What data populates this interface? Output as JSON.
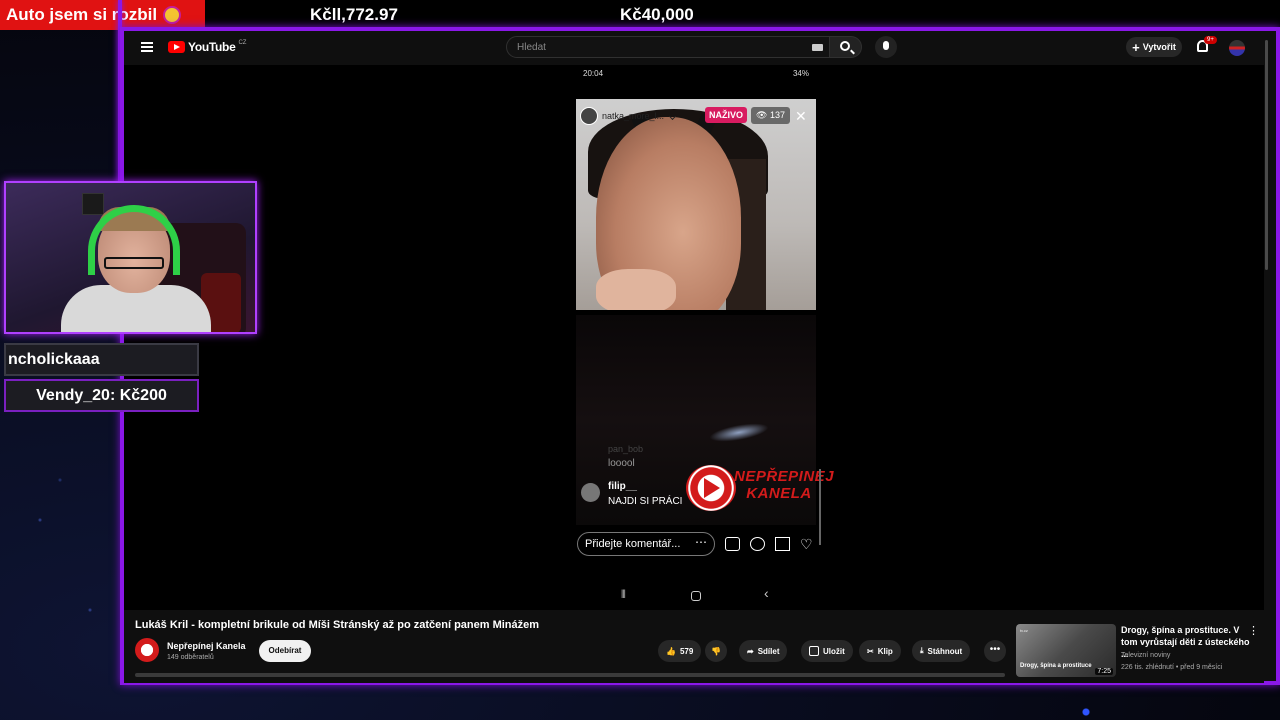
{
  "overlay": {
    "alert_text": "Auto jsem si rozbil",
    "goal_left": "Kčll,772.97",
    "goal_right": "Kč40,000",
    "event_user": "ncholickaaa",
    "event_donation": "Vendy_20: Kč200",
    "accent_color": "#8a18e8"
  },
  "youtube": {
    "logo": "YouTube",
    "logo_region": "CZ",
    "search_placeholder": "Hledat",
    "create_label": "Vytvořit",
    "notif_badge": "9+"
  },
  "phone": {
    "status_time": "20:04",
    "status_battery": "34%",
    "live_user": "natka_more_l...",
    "live_badge": "NAŽIVO",
    "viewers": "137",
    "faded_comment_user": "pan_bob",
    "faded_comment_text": "looool",
    "comment_user": "filip__",
    "comment_text": "NAJDI SI PRÁCI",
    "watermark": "NEPŘEPINEJ KANELA",
    "comment_placeholder": "Přidejte komentář..."
  },
  "video": {
    "title": "Lukáš Kril - kompletní brikule od Míši Stránský až po zatčení panem Minážem",
    "channel": "Nepřepínej Kanela",
    "subscribers": "149 odběratelů",
    "subscribe_label": "Odebírat",
    "likes": "579",
    "share_label": "Sdílet",
    "save_label": "Uložit",
    "clip_label": "Klip",
    "download_label": "Stáhnout",
    "progress": 0.0
  },
  "recommended": {
    "title": "Drogy, špína a prostituce. V tom vyrůstají děti z ústeckého ...",
    "channel": "Televizní noviny",
    "meta": "226 tis. zhlédnutí • před 9 měsíci",
    "duration": "7:25",
    "thumb_text": "Drogy, špína a prostituce",
    "thumb_channel": "tv.cz"
  }
}
